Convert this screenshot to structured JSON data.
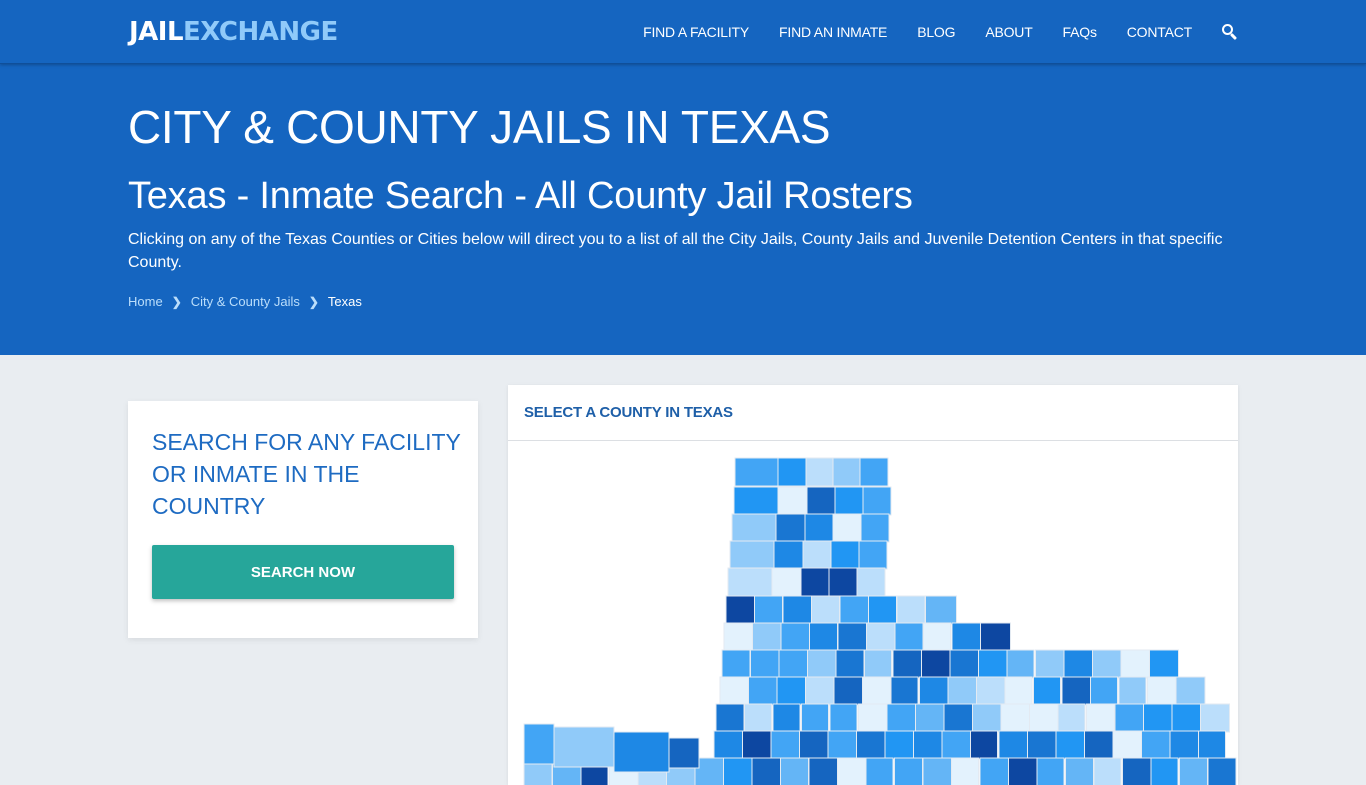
{
  "navbar": {
    "logo": {
      "part1": "JAIL",
      "part2": "EXCHANGE"
    },
    "links": [
      {
        "label": "FIND A FACILITY"
      },
      {
        "label": "FIND AN INMATE"
      },
      {
        "label": "BLOG"
      },
      {
        "label": "ABOUT"
      },
      {
        "label": "FAQs"
      },
      {
        "label": "CONTACT"
      }
    ],
    "search_icon": "search-icon"
  },
  "hero": {
    "title": "CITY & COUNTY JAILS IN TEXAS",
    "subtitle": "Texas - Inmate Search - All County Jail Rosters",
    "description": "Clicking on any of the Texas Counties or Cities below will direct you to a list of all the City Jails, County Jails and Juvenile Detention Centers in that specific County.",
    "breadcrumb": [
      {
        "label": "Home"
      },
      {
        "label": "City & County Jails"
      },
      {
        "label": "Texas",
        "current": true
      }
    ]
  },
  "search_card": {
    "heading": "SEARCH FOR ANY FACILITY OR INMATE IN THE COUNTRY",
    "button_label": "SEARCH NOW"
  },
  "map_card": {
    "header": "SELECT A COUNTY IN TEXAS",
    "map_state": "Texas",
    "palette": [
      "#e3f2fd",
      "#bbdefb",
      "#90caf9",
      "#64b5f6",
      "#42a5f5",
      "#2196f3",
      "#1e88e5",
      "#1976d2",
      "#1565c0",
      "#0d47a1"
    ]
  }
}
